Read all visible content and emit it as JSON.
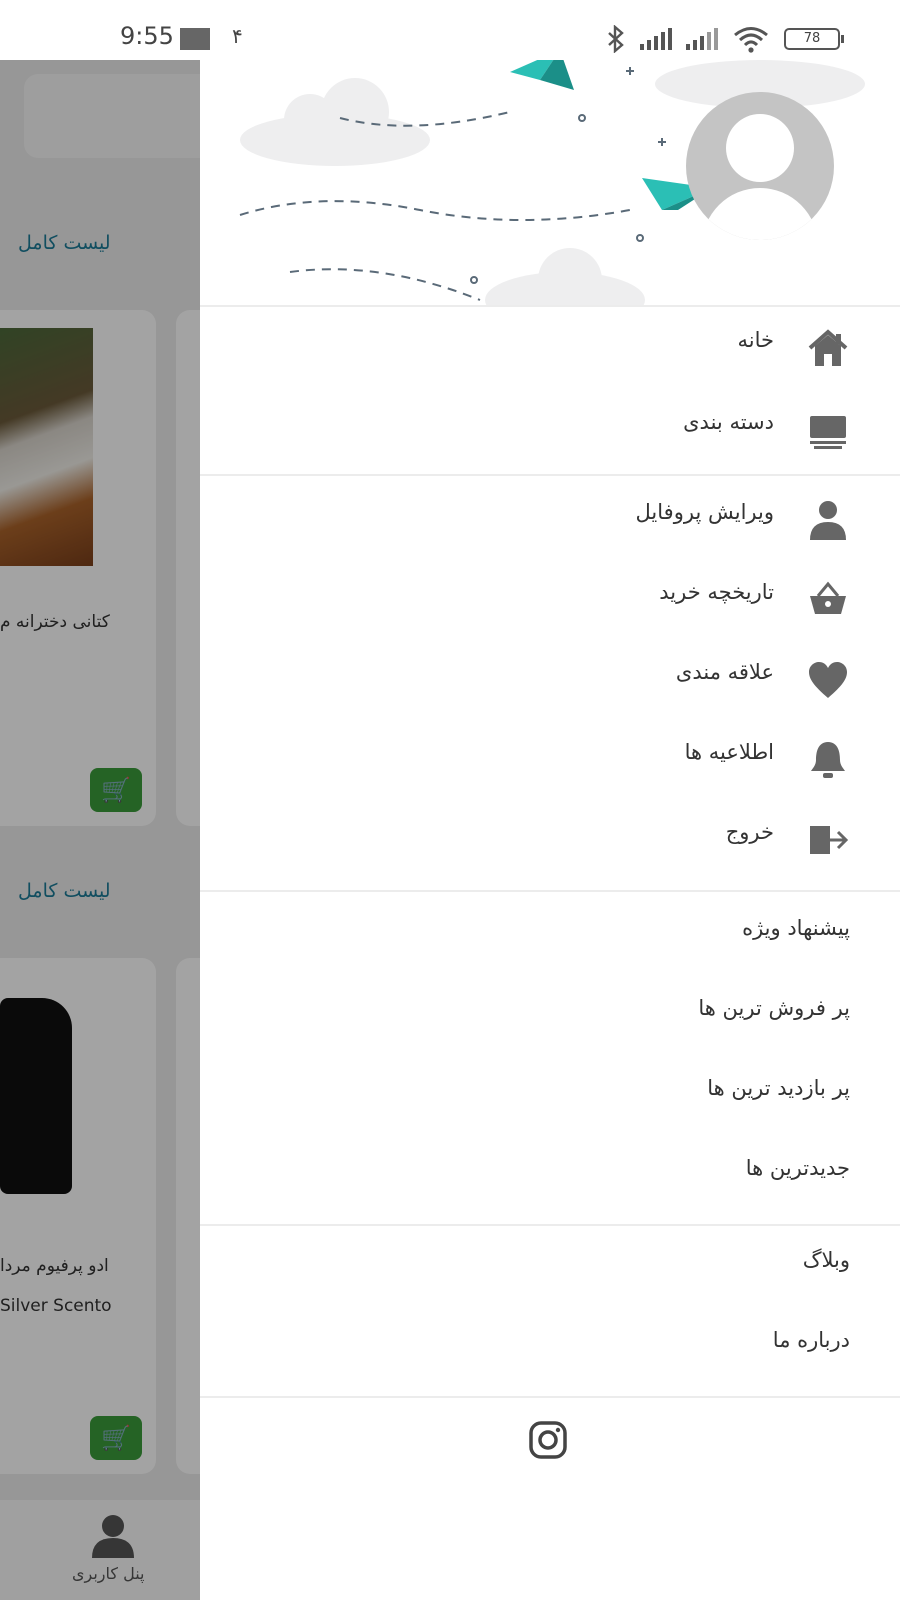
{
  "status_bar": {
    "time": "9:55",
    "extra_digit": "۴",
    "battery": "78",
    "icons": [
      "bluetooth-icon",
      "signal-icon",
      "signal-icon",
      "wifi-icon",
      "battery-icon"
    ]
  },
  "background_page": {
    "sections": [
      {
        "list_link": "لیست کامل",
        "product_title": "کتانی دخترانه م",
        "product_subtitle": "",
        "product_image": "sneaker"
      },
      {
        "list_link": "لیست کامل",
        "product_title": "ادو پرفیوم مردا",
        "product_subtitle": "Silver Scento",
        "product_image": "perfume"
      }
    ],
    "bottom_nav": {
      "user_panel_label": "پنل کاربری"
    }
  },
  "drawer": {
    "primary_items": [
      {
        "label": "خانه",
        "icon": "home-icon"
      },
      {
        "label": "دسته بندی",
        "icon": "category-icon"
      }
    ],
    "account_items": [
      {
        "label": "ویرایش پروفایل",
        "icon": "user-icon"
      },
      {
        "label": "تاریخچه خرید",
        "icon": "basket-icon"
      },
      {
        "label": "علاقه مندی",
        "icon": "heart-icon"
      },
      {
        "label": "اطلاعیه ها",
        "icon": "bell-icon"
      },
      {
        "label": "خروج",
        "icon": "logout-icon"
      }
    ],
    "product_links": [
      {
        "label": "پیشنهاد ویژه"
      },
      {
        "label": "پر فروش ترین ها"
      },
      {
        "label": "پر بازدید ترین ها"
      },
      {
        "label": "جدیدترین ها"
      }
    ],
    "info_links": [
      {
        "label": "وبلاگ"
      },
      {
        "label": "درباره ما"
      }
    ],
    "footer_icon": "instagram-icon"
  },
  "colors": {
    "list_link": "#1c7a96",
    "cart_button": "#3a9b3a",
    "icon_gray": "#666666",
    "plane_teal": "#2bbfb5"
  }
}
